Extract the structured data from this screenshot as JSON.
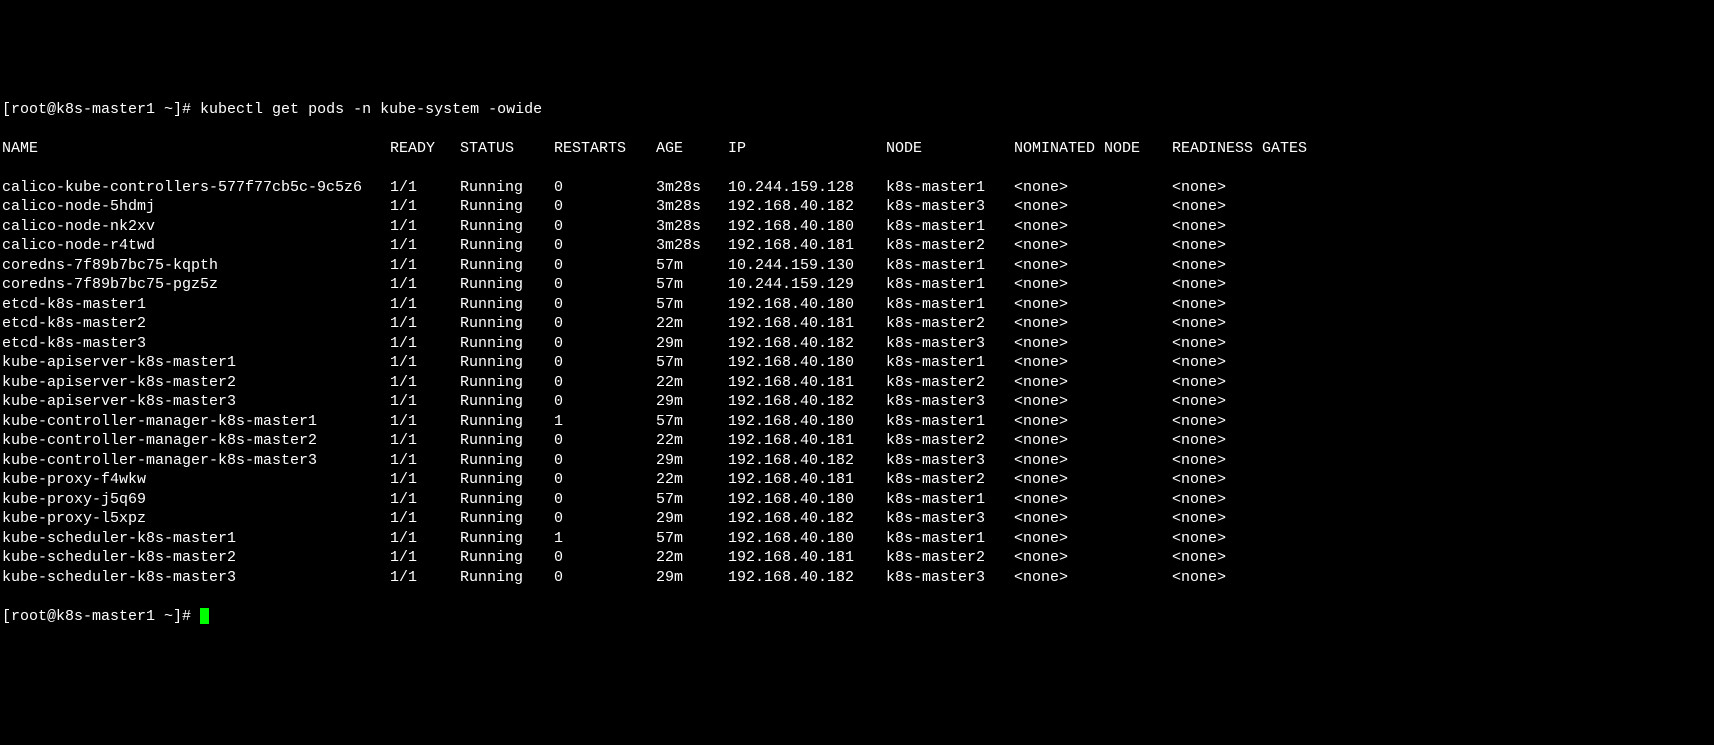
{
  "prompt_prefix": "[root@k8s-master1 ~]# ",
  "command": "kubectl get pods -n kube-system -owide",
  "prompt_end": "[root@k8s-master1 ~]# ",
  "headers": {
    "name": "NAME",
    "ready": "READY",
    "status": "STATUS",
    "restarts": "RESTARTS",
    "age": "AGE",
    "ip": "IP",
    "node": "NODE",
    "nominated": "NOMINATED NODE",
    "readiness": "READINESS GATES"
  },
  "rows": [
    {
      "name": "calico-kube-controllers-577f77cb5c-9c5z6",
      "ready": "1/1",
      "status": "Running",
      "restarts": "0",
      "age": "3m28s",
      "ip": "10.244.159.128",
      "node": "k8s-master1",
      "nominated": "<none>",
      "readiness": "<none>"
    },
    {
      "name": "calico-node-5hdmj",
      "ready": "1/1",
      "status": "Running",
      "restarts": "0",
      "age": "3m28s",
      "ip": "192.168.40.182",
      "node": "k8s-master3",
      "nominated": "<none>",
      "readiness": "<none>"
    },
    {
      "name": "calico-node-nk2xv",
      "ready": "1/1",
      "status": "Running",
      "restarts": "0",
      "age": "3m28s",
      "ip": "192.168.40.180",
      "node": "k8s-master1",
      "nominated": "<none>",
      "readiness": "<none>"
    },
    {
      "name": "calico-node-r4twd",
      "ready": "1/1",
      "status": "Running",
      "restarts": "0",
      "age": "3m28s",
      "ip": "192.168.40.181",
      "node": "k8s-master2",
      "nominated": "<none>",
      "readiness": "<none>"
    },
    {
      "name": "coredns-7f89b7bc75-kqpth",
      "ready": "1/1",
      "status": "Running",
      "restarts": "0",
      "age": "57m",
      "ip": "10.244.159.130",
      "node": "k8s-master1",
      "nominated": "<none>",
      "readiness": "<none>"
    },
    {
      "name": "coredns-7f89b7bc75-pgz5z",
      "ready": "1/1",
      "status": "Running",
      "restarts": "0",
      "age": "57m",
      "ip": "10.244.159.129",
      "node": "k8s-master1",
      "nominated": "<none>",
      "readiness": "<none>"
    },
    {
      "name": "etcd-k8s-master1",
      "ready": "1/1",
      "status": "Running",
      "restarts": "0",
      "age": "57m",
      "ip": "192.168.40.180",
      "node": "k8s-master1",
      "nominated": "<none>",
      "readiness": "<none>"
    },
    {
      "name": "etcd-k8s-master2",
      "ready": "1/1",
      "status": "Running",
      "restarts": "0",
      "age": "22m",
      "ip": "192.168.40.181",
      "node": "k8s-master2",
      "nominated": "<none>",
      "readiness": "<none>"
    },
    {
      "name": "etcd-k8s-master3",
      "ready": "1/1",
      "status": "Running",
      "restarts": "0",
      "age": "29m",
      "ip": "192.168.40.182",
      "node": "k8s-master3",
      "nominated": "<none>",
      "readiness": "<none>"
    },
    {
      "name": "kube-apiserver-k8s-master1",
      "ready": "1/1",
      "status": "Running",
      "restarts": "0",
      "age": "57m",
      "ip": "192.168.40.180",
      "node": "k8s-master1",
      "nominated": "<none>",
      "readiness": "<none>"
    },
    {
      "name": "kube-apiserver-k8s-master2",
      "ready": "1/1",
      "status": "Running",
      "restarts": "0",
      "age": "22m",
      "ip": "192.168.40.181",
      "node": "k8s-master2",
      "nominated": "<none>",
      "readiness": "<none>"
    },
    {
      "name": "kube-apiserver-k8s-master3",
      "ready": "1/1",
      "status": "Running",
      "restarts": "0",
      "age": "29m",
      "ip": "192.168.40.182",
      "node": "k8s-master3",
      "nominated": "<none>",
      "readiness": "<none>"
    },
    {
      "name": "kube-controller-manager-k8s-master1",
      "ready": "1/1",
      "status": "Running",
      "restarts": "1",
      "age": "57m",
      "ip": "192.168.40.180",
      "node": "k8s-master1",
      "nominated": "<none>",
      "readiness": "<none>"
    },
    {
      "name": "kube-controller-manager-k8s-master2",
      "ready": "1/1",
      "status": "Running",
      "restarts": "0",
      "age": "22m",
      "ip": "192.168.40.181",
      "node": "k8s-master2",
      "nominated": "<none>",
      "readiness": "<none>"
    },
    {
      "name": "kube-controller-manager-k8s-master3",
      "ready": "1/1",
      "status": "Running",
      "restarts": "0",
      "age": "29m",
      "ip": "192.168.40.182",
      "node": "k8s-master3",
      "nominated": "<none>",
      "readiness": "<none>"
    },
    {
      "name": "kube-proxy-f4wkw",
      "ready": "1/1",
      "status": "Running",
      "restarts": "0",
      "age": "22m",
      "ip": "192.168.40.181",
      "node": "k8s-master2",
      "nominated": "<none>",
      "readiness": "<none>"
    },
    {
      "name": "kube-proxy-j5q69",
      "ready": "1/1",
      "status": "Running",
      "restarts": "0",
      "age": "57m",
      "ip": "192.168.40.180",
      "node": "k8s-master1",
      "nominated": "<none>",
      "readiness": "<none>"
    },
    {
      "name": "kube-proxy-l5xpz",
      "ready": "1/1",
      "status": "Running",
      "restarts": "0",
      "age": "29m",
      "ip": "192.168.40.182",
      "node": "k8s-master3",
      "nominated": "<none>",
      "readiness": "<none>"
    },
    {
      "name": "kube-scheduler-k8s-master1",
      "ready": "1/1",
      "status": "Running",
      "restarts": "1",
      "age": "57m",
      "ip": "192.168.40.180",
      "node": "k8s-master1",
      "nominated": "<none>",
      "readiness": "<none>"
    },
    {
      "name": "kube-scheduler-k8s-master2",
      "ready": "1/1",
      "status": "Running",
      "restarts": "0",
      "age": "22m",
      "ip": "192.168.40.181",
      "node": "k8s-master2",
      "nominated": "<none>",
      "readiness": "<none>"
    },
    {
      "name": "kube-scheduler-k8s-master3",
      "ready": "1/1",
      "status": "Running",
      "restarts": "0",
      "age": "29m",
      "ip": "192.168.40.182",
      "node": "k8s-master3",
      "nominated": "<none>",
      "readiness": "<none>"
    }
  ]
}
